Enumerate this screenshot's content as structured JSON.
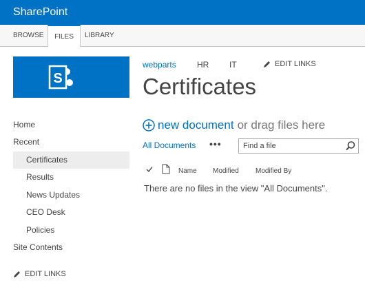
{
  "suite": {
    "title": "SharePoint"
  },
  "ribbon": {
    "tabs": [
      {
        "label": "BROWSE",
        "selected": false
      },
      {
        "label": "FILES",
        "selected": true
      },
      {
        "label": "LIBRARY",
        "selected": false
      }
    ]
  },
  "top_nav": {
    "items": [
      {
        "label": "webparts"
      },
      {
        "label": "HR"
      },
      {
        "label": "IT"
      }
    ],
    "edit_links": "EDIT LINKS"
  },
  "page": {
    "title": "Certificates"
  },
  "new_document": {
    "link_label": "new document",
    "suffix": "or drag files here"
  },
  "views": {
    "current": "All Documents",
    "more": "•••"
  },
  "search": {
    "placeholder": "Find a file",
    "value": ""
  },
  "columns": [
    "Name",
    "Modified",
    "Modified By"
  ],
  "empty_message": "There are no files in the view \"All Documents\".",
  "left_nav": {
    "items": [
      {
        "label": "Home",
        "level": 0,
        "selected": false
      },
      {
        "label": "Recent",
        "level": 0,
        "selected": false
      },
      {
        "label": "Certificates",
        "level": 1,
        "selected": true
      },
      {
        "label": "Results",
        "level": 1,
        "selected": false
      },
      {
        "label": "News Updates",
        "level": 1,
        "selected": false
      },
      {
        "label": "CEO Desk",
        "level": 1,
        "selected": false
      },
      {
        "label": "Policies",
        "level": 1,
        "selected": false
      },
      {
        "label": "Site Contents",
        "level": 0,
        "selected": false
      }
    ],
    "edit_links": "EDIT LINKS"
  },
  "icons": {
    "logo": "sharepoint-logo-icon",
    "edit": "pencil-icon",
    "add": "plus-circle-icon",
    "search": "magnifier-icon",
    "check": "checkmark-icon",
    "file": "document-icon"
  },
  "colors": {
    "brand": "#0072c6",
    "selected_bg": "#ededed",
    "text": "#444444"
  }
}
